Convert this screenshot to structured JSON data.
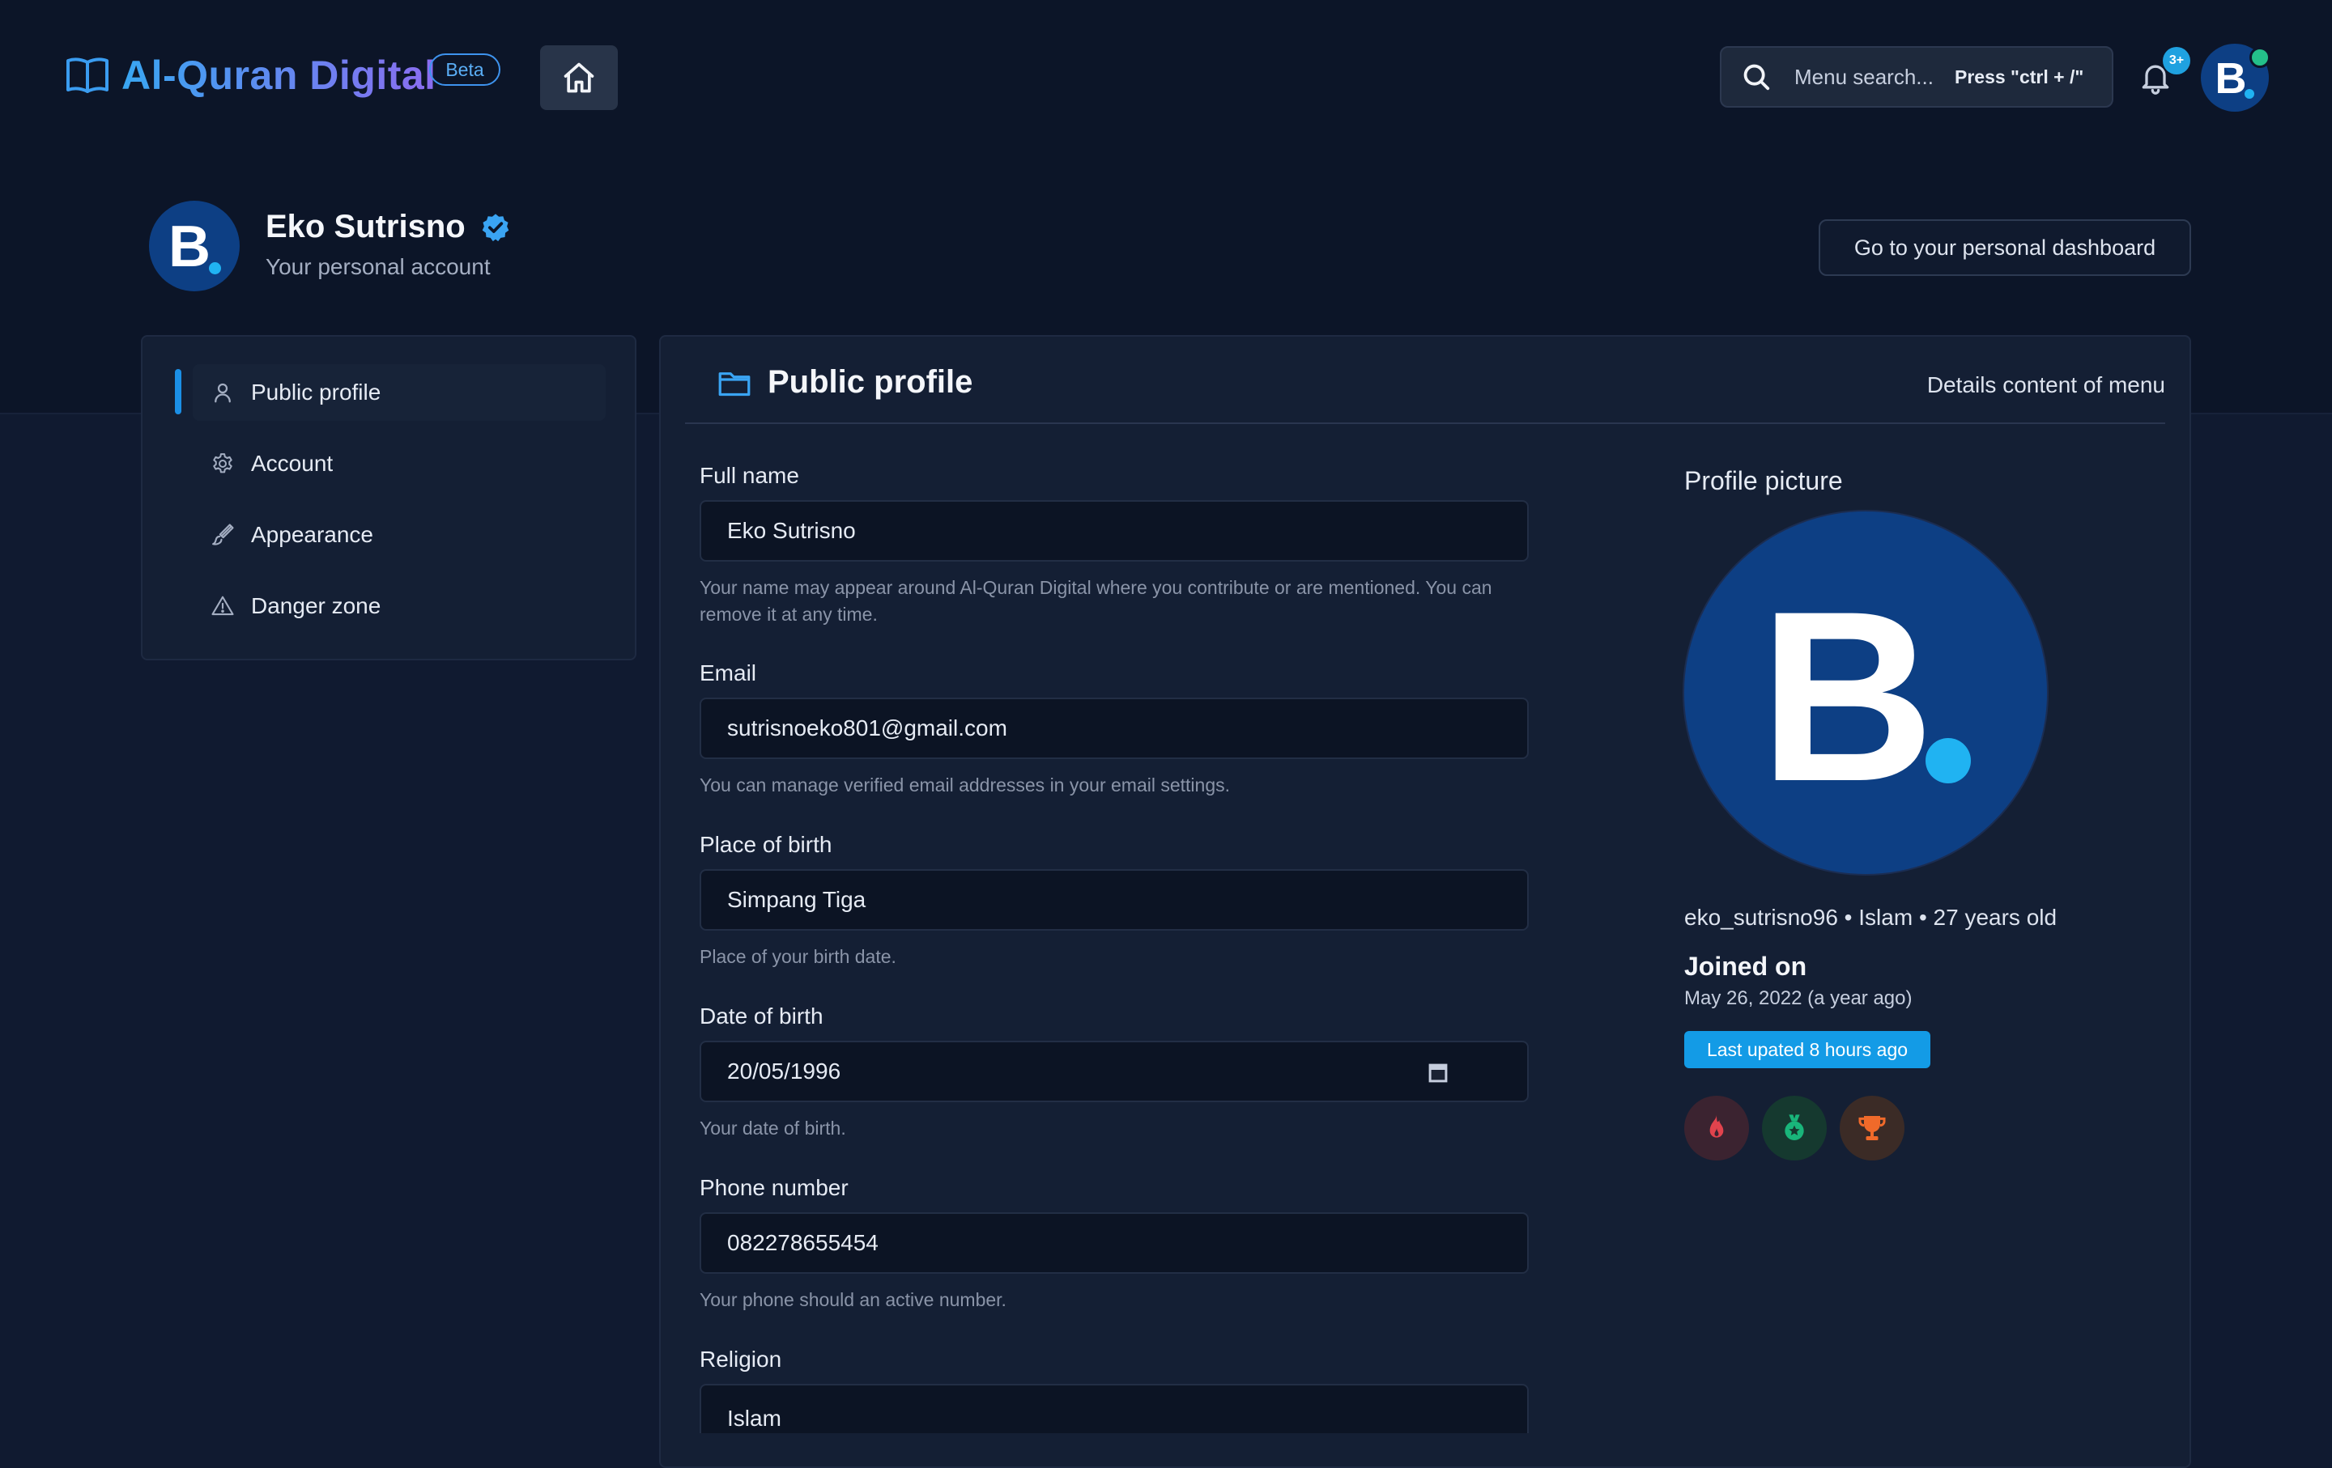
{
  "app": {
    "brand": "Al-Quran Digital",
    "beta_label": "Beta",
    "search_placeholder": "Menu search...",
    "search_shortcut": "Press \"ctrl + /\"",
    "notification_count": "3+",
    "avatar_letter": "B"
  },
  "header": {
    "name": "Eko Sutrisno",
    "subtitle": "Your personal account",
    "dashboard_button": "Go to your personal dashboard"
  },
  "sidebar": {
    "items": [
      {
        "label": "Public profile",
        "icon": "user-icon",
        "active": true
      },
      {
        "label": "Account",
        "icon": "gear-icon",
        "active": false
      },
      {
        "label": "Appearance",
        "icon": "brush-icon",
        "active": false
      },
      {
        "label": "Danger zone",
        "icon": "warning-icon",
        "active": false
      }
    ]
  },
  "panel": {
    "title": "Public profile",
    "detail": "Details content of menu"
  },
  "form": {
    "fields": [
      {
        "label": "Full name",
        "value": "Eko Sutrisno",
        "help": "Your name may appear around Al-Quran Digital where you contribute or are mentioned. You can remove it at any time."
      },
      {
        "label": "Email",
        "value": "sutrisnoeko801@gmail.com",
        "help": "You can manage verified email addresses in your email settings."
      },
      {
        "label": "Place of birth",
        "value": "Simpang Tiga",
        "help": "Place of your birth date."
      },
      {
        "label": "Date of birth",
        "value": "20/05/1996",
        "help": "Your date of birth."
      },
      {
        "label": "Phone number",
        "value": "082278655454",
        "help": "Your phone should an active number."
      },
      {
        "label": "Religion",
        "value": "Islam",
        "help": ""
      }
    ]
  },
  "profile_picture": {
    "label": "Profile picture",
    "meta": "eko_sutrisno96 • Islam • 27 years old",
    "joined_label": "Joined on",
    "joined_date": "May 26, 2022 (a year ago)",
    "updated_badge": "Last upated 8 hours ago",
    "achievements": [
      "flame-icon",
      "medal-icon",
      "trophy-icon"
    ]
  },
  "colors": {
    "accent": "#1b8fe6",
    "avatar_bg": "#0d3f84",
    "avatar_dot": "#20b3f2",
    "online": "#24c08a"
  }
}
